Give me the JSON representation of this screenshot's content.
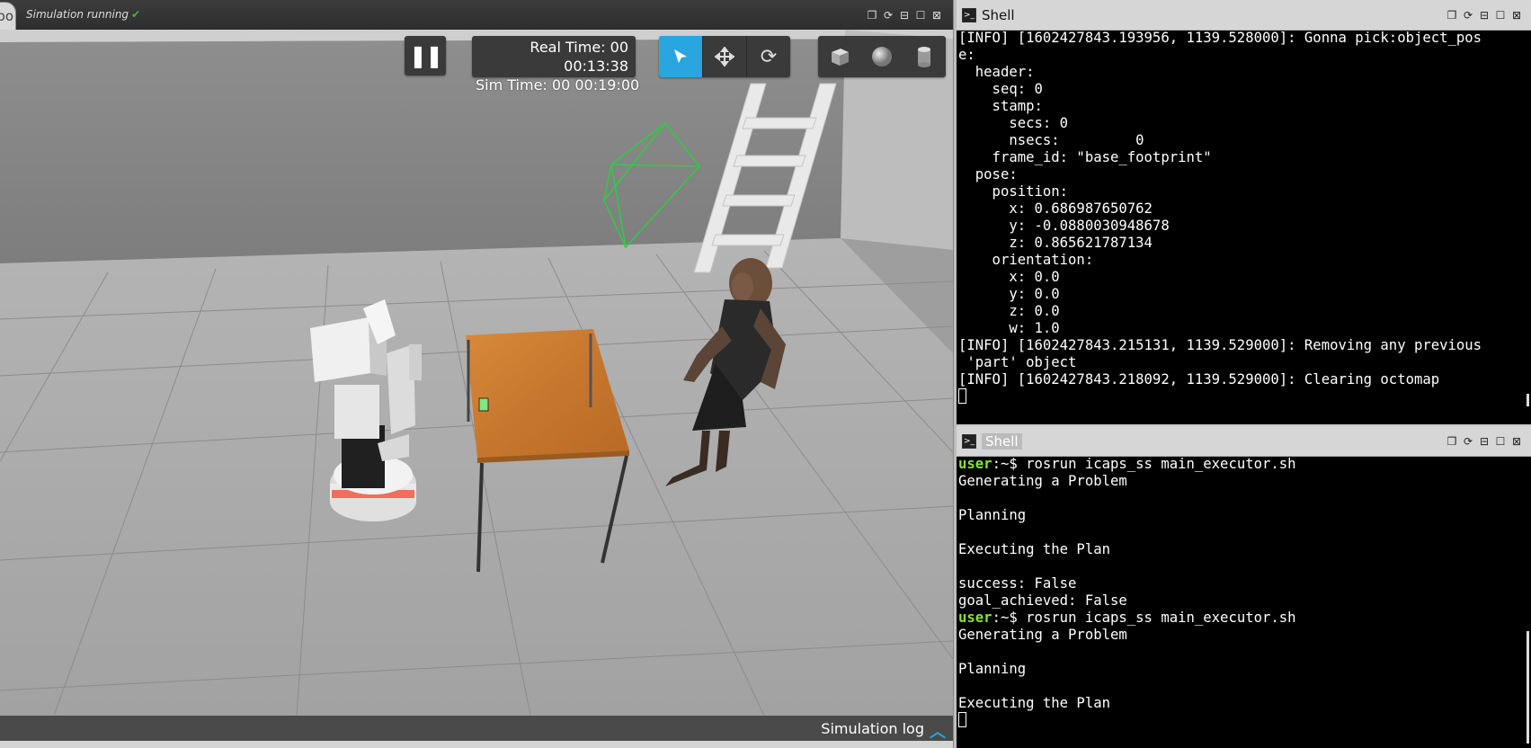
{
  "sim": {
    "logo_text": "bo",
    "status": "Simulation running",
    "real_time_label": "Real Time: 00",
    "real_time_value": "00:13:38",
    "sim_time": "Sim Time: 00 00:19:00",
    "footer_label": "Simulation log",
    "tools": [
      "select-tool",
      "translate-tool",
      "rotate-tool"
    ],
    "shapes": [
      "box-shape",
      "sphere-shape",
      "cylinder-shape"
    ],
    "colors": {
      "accent": "#29a6df",
      "running": "#4caf50"
    }
  },
  "shell_top": {
    "title": "Shell",
    "lines": [
      "[INFO] [1602427843.193956, 1139.528000]: Gonna pick:object_pos",
      "e:",
      "  header:",
      "    seq: 0",
      "    stamp:",
      "      secs: 0",
      "      nsecs:         0",
      "    frame_id: \"base_footprint\"",
      "  pose:",
      "    position:",
      "      x: 0.686987650762",
      "      y: -0.0880030948678",
      "      z: 0.865621787134",
      "    orientation:",
      "      x: 0.0",
      "      y: 0.0",
      "      z: 0.0",
      "      w: 1.0",
      "[INFO] [1602427843.215131, 1139.529000]: Removing any previous",
      " 'part' object",
      "[INFO] [1602427843.218092, 1139.529000]: Clearing octomap"
    ]
  },
  "shell_bottom": {
    "title": "Shell",
    "prompt_user": "user",
    "prompt_sep": ":~$",
    "command": " rosrun icaps_ss main_executor.sh",
    "lines1": [
      "Generating a Problem",
      "",
      "Planning",
      "",
      "Executing the Plan",
      "",
      "success: False",
      "goal_achieved: False"
    ],
    "lines2": [
      "Generating a Problem",
      "",
      "Planning",
      "",
      "Executing the Plan",
      ""
    ]
  }
}
